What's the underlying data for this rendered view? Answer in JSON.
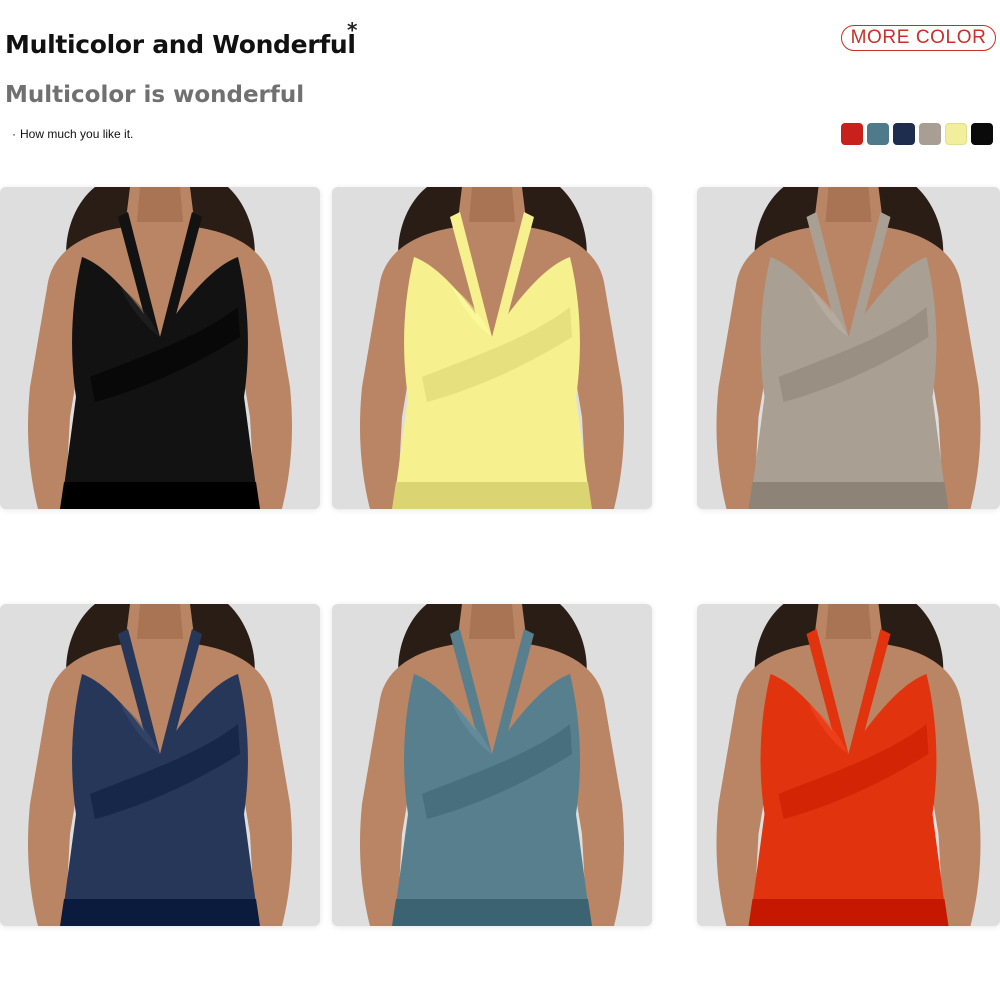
{
  "header": {
    "title": "Multicolor and Wonderful",
    "asterisk": "*",
    "subtitle": "Multicolor is wonderful",
    "note_bullet": "·",
    "note": "How much you like it.",
    "more_color_label": "MORE COLOR",
    "accent_color": "#c8302a"
  },
  "swatches": [
    {
      "name": "red",
      "color": "#c8201a"
    },
    {
      "name": "slate-blue",
      "color": "#4e7a8a"
    },
    {
      "name": "navy",
      "color": "#1e2c4e"
    },
    {
      "name": "taupe",
      "color": "#a89e93"
    },
    {
      "name": "pale-yellow",
      "color": "#f1ee9c"
    },
    {
      "name": "black",
      "color": "#0a0a0a"
    }
  ],
  "products": [
    {
      "name": "black-halter-top",
      "color": "#121212"
    },
    {
      "name": "yellow-halter-top",
      "color": "#f6f08e"
    },
    {
      "name": "taupe-halter-top",
      "color": "#a99f93"
    },
    {
      "name": "navy-halter-top",
      "color": "#27375a"
    },
    {
      "name": "slate-blue-halter-top",
      "color": "#577f8d"
    },
    {
      "name": "red-halter-top",
      "color": "#e2330f"
    }
  ]
}
